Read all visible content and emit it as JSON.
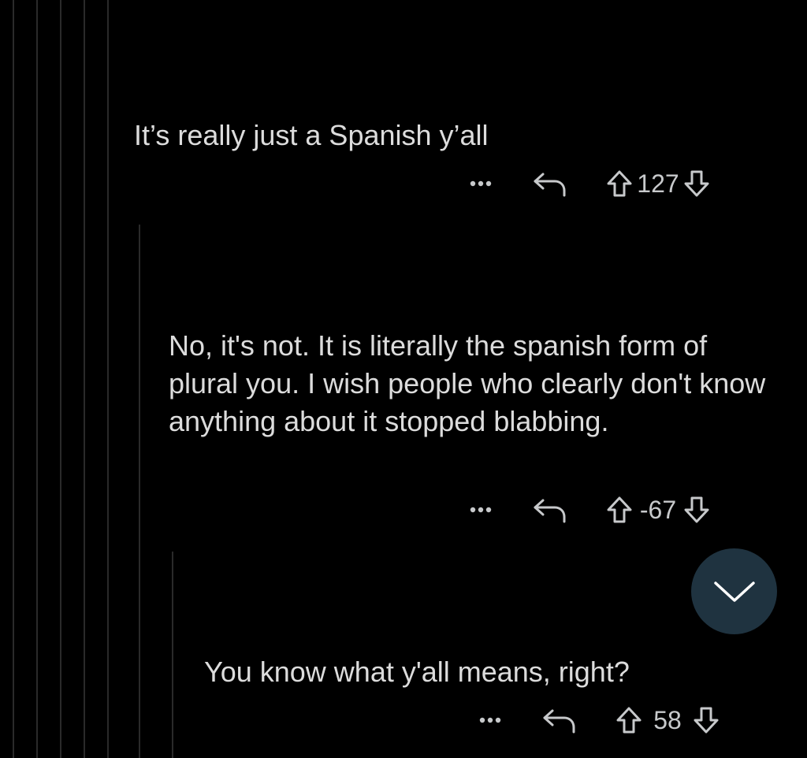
{
  "comments": [
    {
      "text": "It’s really just a Spanish y’all",
      "score": "127"
    },
    {
      "text": "No, it's not. It is literally the spanish form of plural you. I wish people who clearly don't know anything about it stopped blabbing.",
      "score": "-67"
    },
    {
      "text": "You know what y'all means, right?",
      "score": "58"
    }
  ],
  "icons": {
    "more": "more-options-icon",
    "reply": "reply-icon",
    "upvote": "upvote-icon",
    "downvote": "downvote-icon",
    "scroll": "chevron-down-icon"
  },
  "colors": {
    "background": "#000000",
    "text": "#dcdcdc",
    "icon": "#c7c9cb",
    "thread_line": "#2a2a2a",
    "scroll_button": "#1f3340"
  }
}
